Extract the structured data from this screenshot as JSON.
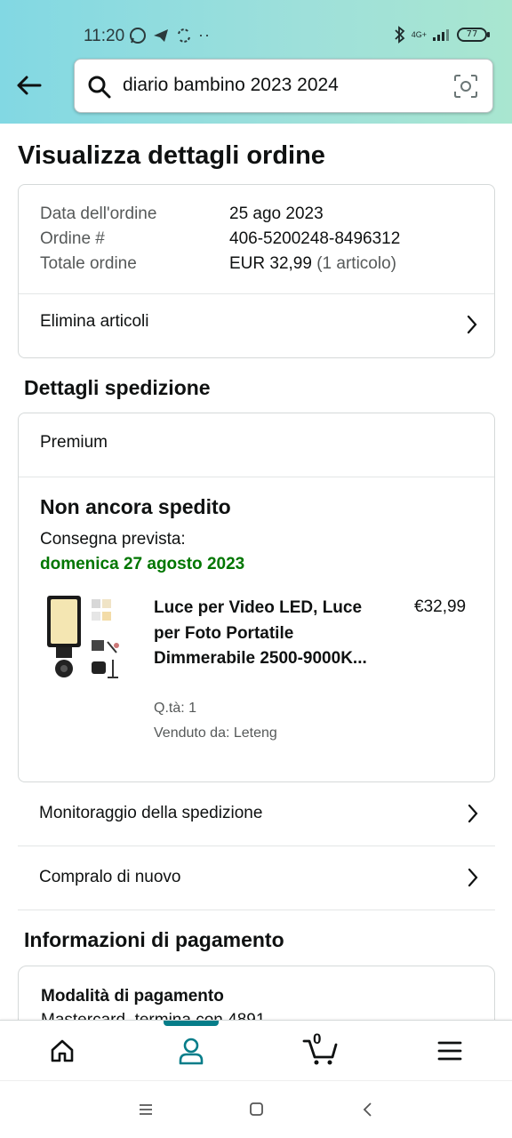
{
  "status_bar": {
    "time": "11:20",
    "battery": "77",
    "network": "4G+"
  },
  "search": {
    "query": "diario bambino 2023 2024"
  },
  "page": {
    "title": "Visualizza dettagli ordine"
  },
  "order_summary": {
    "rows": [
      {
        "label": "Data dell'ordine",
        "value": "25 ago 2023",
        "extra": ""
      },
      {
        "label": "Ordine #",
        "value": "406-5200248-8496312",
        "extra": ""
      },
      {
        "label": "Totale ordine",
        "value": "EUR 32,99",
        "extra": "(1 articolo)"
      }
    ],
    "action": "Elimina articoli"
  },
  "shipping": {
    "section_title": "Dettagli spedizione",
    "service": "Premium",
    "status": "Non ancora spedito",
    "eta_label": "Consegna prevista:",
    "eta_date": "domenica 27 agosto 2023",
    "product": {
      "title": "Luce per Video LED, Luce per Foto Portatile Dimmerabile 2500-9000K...",
      "price": "€32,99",
      "qty": "Q.tà: 1",
      "seller": "Venduto da: Leteng"
    },
    "actions": [
      "Monitoraggio della spedizione",
      "Compralo di nuovo"
    ]
  },
  "payment": {
    "section_title": "Informazioni di pagamento",
    "method_title": "Modalità di pagamento",
    "method_detail": "Mastercard, termina con 4891"
  },
  "bottom_nav": {
    "cart_count": "0",
    "items": [
      "home-icon",
      "account-icon",
      "cart-icon",
      "menu-icon"
    ],
    "active": "account-icon"
  },
  "colors": {
    "header_gradient_start": "#82d8e3",
    "header_gradient_end": "#a9e6d0",
    "delivery_green": "#007600",
    "active_tab": "#067d89"
  }
}
